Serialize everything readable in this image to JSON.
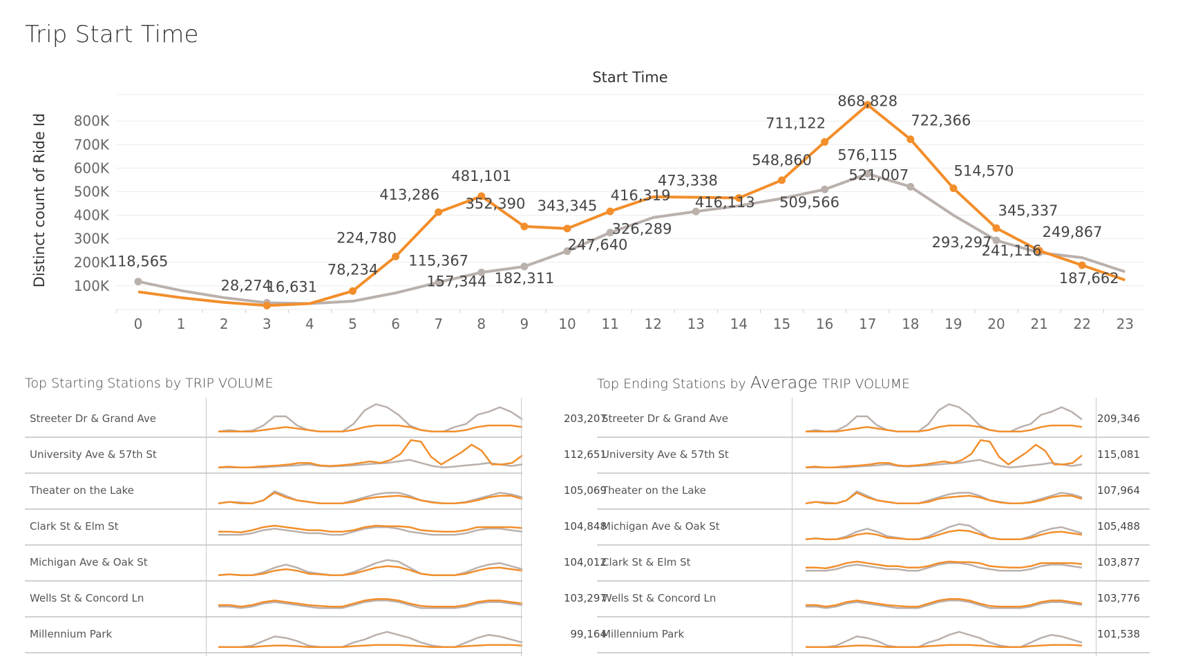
{
  "page": {
    "title": "Trip Start Time"
  },
  "colors": {
    "orange": "#f28e2b",
    "gray": "#bab0ac",
    "axis": "#666666",
    "grid": "#ececec"
  },
  "chart_data": [
    {
      "type": "line",
      "title": "Start Time",
      "ylabel": "Distinct count of Ride Id",
      "xlabel": "",
      "x": [
        0,
        1,
        2,
        3,
        4,
        5,
        6,
        7,
        8,
        9,
        10,
        11,
        12,
        13,
        14,
        15,
        16,
        17,
        18,
        19,
        20,
        21,
        22,
        23
      ],
      "ylim": [
        0,
        900000
      ],
      "yticks": [
        "100K",
        "200K",
        "300K",
        "400K",
        "500K",
        "600K",
        "700K",
        "800K"
      ],
      "grid": true,
      "series": [
        {
          "color": "#bab0ac",
          "values": [
            118565,
            80000,
            50000,
            28274,
            25000,
            35000,
            70000,
            115367,
            157344,
            182311,
            247640,
            326289,
            390000,
            416113,
            440000,
            471000,
            509566,
            576115,
            521007,
            400000,
            293297,
            241116,
            220000,
            160000
          ],
          "labels": [
            {
              "x": 0,
              "text": "118,565"
            },
            {
              "x": 3,
              "text": "28,274"
            },
            {
              "x": 7,
              "text": "115,367"
            },
            {
              "x": 8,
              "text": "157,344"
            },
            {
              "x": 9,
              "text": "182,311"
            },
            {
              "x": 10,
              "text": "247,640"
            },
            {
              "x": 11,
              "text": "326,289"
            },
            {
              "x": 13,
              "text": "416,113"
            },
            {
              "x": 16,
              "text": "509,566"
            },
            {
              "x": 17,
              "text": "576,115"
            },
            {
              "x": 18,
              "text": "521,007"
            },
            {
              "x": 20,
              "text": "293,297"
            },
            {
              "x": 21,
              "text": "241,116"
            }
          ]
        },
        {
          "color": "#f28e2b",
          "values": [
            75000,
            50000,
            30000,
            16631,
            25000,
            78234,
            224780,
            413286,
            481101,
            352390,
            343345,
            416319,
            478000,
            476000,
            473338,
            548860,
            711122,
            868828,
            722366,
            514570,
            345337,
            249867,
            187662,
            125000
          ],
          "labels": [
            {
              "x": 3,
              "text": "16,631"
            },
            {
              "x": 5,
              "text": "78,234"
            },
            {
              "x": 6,
              "text": "224,780"
            },
            {
              "x": 7,
              "text": "413,286"
            },
            {
              "x": 8,
              "text": "481,101"
            },
            {
              "x": 9,
              "text": "352,390"
            },
            {
              "x": 10,
              "text": "343,345"
            },
            {
              "x": 11,
              "text": "416,319"
            },
            {
              "x": 14,
              "text": "473,338"
            },
            {
              "x": 15,
              "text": "548,860"
            },
            {
              "x": 16,
              "text": "711,122"
            },
            {
              "x": 17,
              "text": "868,828"
            },
            {
              "x": 18,
              "text": "722,366"
            },
            {
              "x": 19,
              "text": "514,570"
            },
            {
              "x": 20,
              "text": "345,337"
            },
            {
              "x": 21,
              "text": "249,867"
            },
            {
              "x": 22,
              "text": "187,662"
            }
          ]
        }
      ]
    },
    {
      "type": "table",
      "title_prefix": "Top Starting Stations by",
      "title_metric": "TRIP VOLUME",
      "rows": [
        {
          "station": "Streeter Dr & Grand Ave",
          "value": "203,207"
        },
        {
          "station": "University Ave & 57th St",
          "value": "112,651"
        },
        {
          "station": "Theater on the Lake",
          "value": "105,069"
        },
        {
          "station": "Clark St & Elm St",
          "value": "104,848"
        },
        {
          "station": "Michigan Ave & Oak St",
          "value": "104,012"
        },
        {
          "station": "Wells St & Concord Ln",
          "value": "103,297"
        },
        {
          "station": "Millennium Park",
          "value": "99,164"
        }
      ]
    },
    {
      "type": "table",
      "title_prefix": "Top Ending Stations by",
      "title_metric_large": "Average",
      "title_metric": "TRIP VOLUME",
      "rows": [
        {
          "station": "Streeter Dr & Grand Ave",
          "value": "209,346"
        },
        {
          "station": "University Ave & 57th St",
          "value": "115,081"
        },
        {
          "station": "Theater on the Lake",
          "value": "107,964"
        },
        {
          "station": "Michigan Ave & Oak St",
          "value": "105,488"
        },
        {
          "station": "Clark St & Elm St",
          "value": "103,877"
        },
        {
          "station": "Wells St & Concord Ln",
          "value": "103,776"
        },
        {
          "station": "Millennium Park",
          "value": "101,538"
        }
      ]
    }
  ],
  "sparklines": {
    "Streeter Dr & Grand Ave": {
      "gray": [
        0.05,
        0.1,
        0.05,
        0.08,
        0.25,
        0.55,
        0.55,
        0.25,
        0.1,
        0.05,
        0.05,
        0.05,
        0.3,
        0.75,
        0.95,
        0.85,
        0.6,
        0.25,
        0.1,
        0.05,
        0.05,
        0.2,
        0.3,
        0.6,
        0.7,
        0.85,
        0.7,
        0.45
      ],
      "orange": [
        0.05,
        0.05,
        0.05,
        0.05,
        0.1,
        0.15,
        0.2,
        0.15,
        0.1,
        0.05,
        0.05,
        0.05,
        0.1,
        0.2,
        0.25,
        0.25,
        0.25,
        0.2,
        0.1,
        0.05,
        0.05,
        0.05,
        0.1,
        0.2,
        0.25,
        0.25,
        0.25,
        0.2
      ]
    },
    "University Ave & 57th St": {
      "gray": [
        0.05,
        0.05,
        0.05,
        0.05,
        0.05,
        0.08,
        0.1,
        0.12,
        0.15,
        0.1,
        0.08,
        0.1,
        0.12,
        0.15,
        0.18,
        0.2,
        0.25,
        0.3,
        0.2,
        0.1,
        0.05,
        0.08,
        0.12,
        0.15,
        0.2,
        0.15,
        0.1,
        0.15
      ],
      "orange": [
        0.05,
        0.08,
        0.05,
        0.05,
        0.08,
        0.1,
        0.12,
        0.15,
        0.2,
        0.2,
        0.12,
        0.1,
        0.12,
        0.15,
        0.2,
        0.25,
        0.2,
        0.3,
        0.5,
        0.95,
        0.9,
        0.4,
        0.15,
        0.35,
        0.55,
        0.8,
        0.6,
        0.15,
        0.15,
        0.2,
        0.45
      ]
    },
    "Theater on the Lake": {
      "gray": [
        0.05,
        0.1,
        0.08,
        0.05,
        0.15,
        0.45,
        0.3,
        0.15,
        0.1,
        0.05,
        0.05,
        0.05,
        0.15,
        0.25,
        0.35,
        0.4,
        0.4,
        0.3,
        0.15,
        0.1,
        0.05,
        0.05,
        0.1,
        0.2,
        0.3,
        0.4,
        0.35,
        0.25
      ],
      "orange": [
        0.05,
        0.1,
        0.05,
        0.05,
        0.15,
        0.4,
        0.25,
        0.15,
        0.1,
        0.05,
        0.05,
        0.05,
        0.1,
        0.2,
        0.25,
        0.28,
        0.3,
        0.25,
        0.15,
        0.08,
        0.05,
        0.05,
        0.08,
        0.15,
        0.25,
        0.3,
        0.3,
        0.2
      ]
    },
    "Clark St & Elm St": {
      "gray": [
        0.2,
        0.2,
        0.2,
        0.25,
        0.35,
        0.4,
        0.35,
        0.3,
        0.25,
        0.25,
        0.2,
        0.2,
        0.3,
        0.4,
        0.45,
        0.45,
        0.4,
        0.3,
        0.25,
        0.2,
        0.2,
        0.2,
        0.25,
        0.35,
        0.4,
        0.4,
        0.35,
        0.3
      ],
      "orange": [
        0.3,
        0.3,
        0.28,
        0.35,
        0.45,
        0.5,
        0.45,
        0.4,
        0.35,
        0.35,
        0.3,
        0.3,
        0.35,
        0.45,
        0.5,
        0.48,
        0.48,
        0.45,
        0.35,
        0.32,
        0.3,
        0.3,
        0.35,
        0.45,
        0.45,
        0.45,
        0.45,
        0.42
      ]
    },
    "Michigan Ave & Oak St": {
      "gray": [
        0.05,
        0.08,
        0.05,
        0.05,
        0.15,
        0.3,
        0.4,
        0.3,
        0.15,
        0.1,
        0.05,
        0.05,
        0.15,
        0.3,
        0.45,
        0.55,
        0.5,
        0.3,
        0.1,
        0.05,
        0.05,
        0.05,
        0.15,
        0.3,
        0.4,
        0.45,
        0.35,
        0.25
      ],
      "orange": [
        0.05,
        0.08,
        0.05,
        0.05,
        0.1,
        0.2,
        0.25,
        0.2,
        0.1,
        0.08,
        0.05,
        0.05,
        0.1,
        0.2,
        0.3,
        0.35,
        0.32,
        0.22,
        0.1,
        0.05,
        0.05,
        0.05,
        0.1,
        0.2,
        0.28,
        0.3,
        0.25,
        0.2
      ]
    },
    "Wells St & Concord Ln": {
      "gray": [
        0.2,
        0.2,
        0.15,
        0.2,
        0.3,
        0.35,
        0.3,
        0.25,
        0.2,
        0.15,
        0.15,
        0.15,
        0.25,
        0.35,
        0.4,
        0.4,
        0.35,
        0.25,
        0.15,
        0.15,
        0.15,
        0.15,
        0.2,
        0.3,
        0.35,
        0.35,
        0.3,
        0.25
      ],
      "orange": [
        0.25,
        0.25,
        0.2,
        0.25,
        0.35,
        0.4,
        0.35,
        0.3,
        0.25,
        0.22,
        0.2,
        0.2,
        0.3,
        0.4,
        0.45,
        0.45,
        0.4,
        0.3,
        0.22,
        0.2,
        0.2,
        0.2,
        0.25,
        0.35,
        0.4,
        0.4,
        0.35,
        0.3
      ]
    },
    "Millennium Park": {
      "gray": [
        0.05,
        0.05,
        0.05,
        0.1,
        0.25,
        0.4,
        0.35,
        0.25,
        0.1,
        0.05,
        0.05,
        0.05,
        0.2,
        0.3,
        0.45,
        0.55,
        0.45,
        0.35,
        0.2,
        0.1,
        0.05,
        0.05,
        0.2,
        0.35,
        0.45,
        0.4,
        0.3,
        0.2
      ],
      "orange": [
        0.05,
        0.05,
        0.05,
        0.05,
        0.08,
        0.1,
        0.1,
        0.08,
        0.05,
        0.05,
        0.05,
        0.05,
        0.08,
        0.1,
        0.12,
        0.12,
        0.12,
        0.1,
        0.08,
        0.05,
        0.05,
        0.05,
        0.08,
        0.1,
        0.12,
        0.12,
        0.12,
        0.1
      ]
    }
  }
}
